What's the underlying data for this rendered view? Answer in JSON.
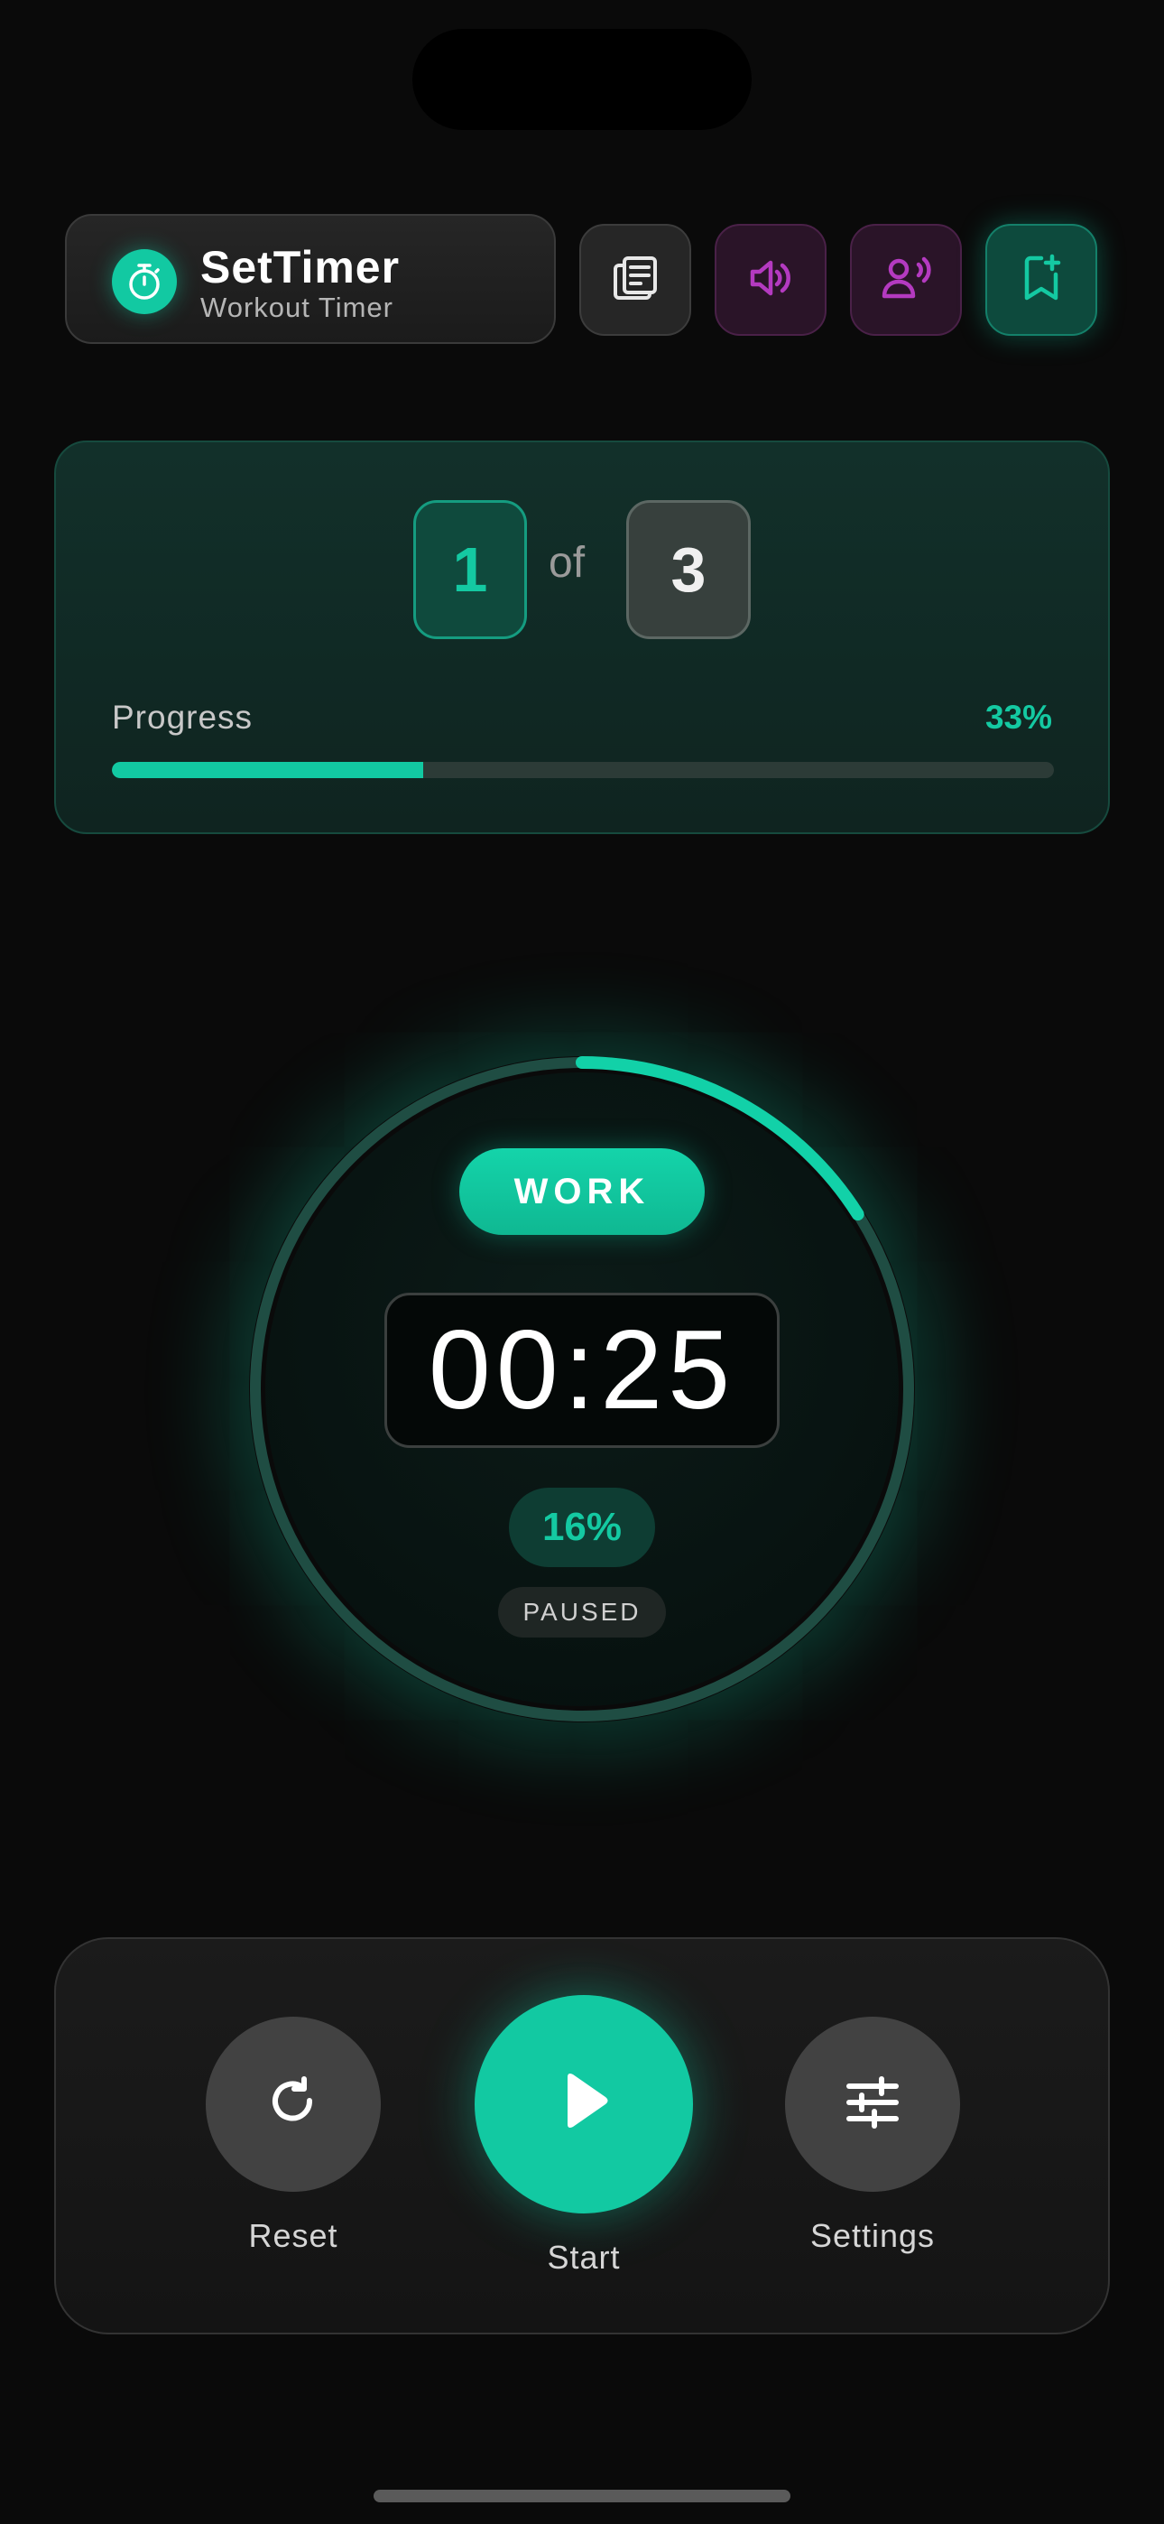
{
  "header": {
    "app_name": "SetTimer",
    "app_subtitle": "Workout Timer",
    "icons": {
      "brand": "stopwatch-icon",
      "notes": "notes-icon",
      "sound": "speaker-icon",
      "voice": "voice-icon",
      "save": "bookmark-add-icon"
    }
  },
  "sets": {
    "current": "1",
    "separator": "of",
    "total": "3"
  },
  "progress": {
    "label": "Progress",
    "value_text": "33%",
    "fraction": 0.33
  },
  "timer": {
    "phase": "WORK",
    "time": "00:25",
    "percent_text": "16%",
    "ring_fraction": 0.16,
    "state": "PAUSED"
  },
  "controls": {
    "reset_label": "Reset",
    "start_label": "Start",
    "settings_label": "Settings",
    "icons": {
      "reset": "reset-icon",
      "start": "play-icon",
      "settings": "sliders-icon"
    }
  },
  "colors": {
    "accent": "#12c9a2",
    "background": "#0a0a0a",
    "purple_accent": "#9b2fa6"
  }
}
